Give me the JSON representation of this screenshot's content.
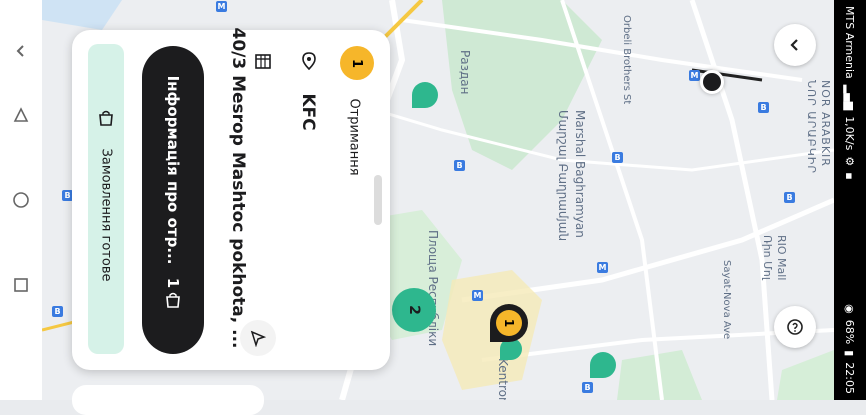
{
  "status": {
    "carrier": "MTS Armenia",
    "speed": "1,0K/s",
    "battery": "68%",
    "time": "22:05"
  },
  "order": {
    "step_number": "1",
    "step_label": "Отримання",
    "restaurant": "KFC",
    "address": "40/3 Mesrop Mashtoc pokhota, ...",
    "info_button": "Інформація про отр...",
    "count": "1",
    "ready_label": "Замовлення готове"
  },
  "map": {
    "labels": [
      {
        "text": "Раздан"
      },
      {
        "text": "Marshal Baghramyan"
      },
      {
        "text": "Մարշալ Բաղրամյան"
      },
      {
        "text": "Orbeli Brothers St"
      },
      {
        "text": "Sayat-Nova Ave"
      },
      {
        "text": "RIO Mall"
      },
      {
        "text": "Ռիո Մոլ"
      },
      {
        "text": "NOR ARABKIR"
      },
      {
        "text": "ՆՈՐ ԱՐԱԲԿԻՐ"
      },
      {
        "text": "Площа Республіки"
      },
      {
        "text": "Kentron"
      }
    ],
    "cluster_number": "2",
    "marker_number": "1"
  },
  "colors": {
    "accent_yellow": "#f6b62a",
    "green": "#2eb78e",
    "dark": "#1c1c1e",
    "mint": "#d6f2e8"
  }
}
